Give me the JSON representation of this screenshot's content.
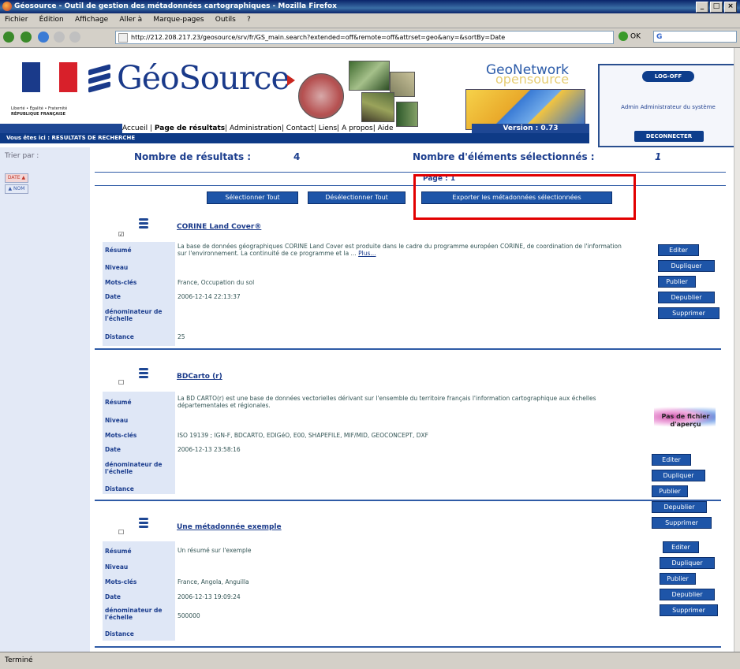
{
  "window": {
    "title": "Géosource - Outil de gestion des métadonnées cartographiques - Mozilla Firefox"
  },
  "menu": [
    "Fichier",
    "Édition",
    "Affichage",
    "Aller à",
    "Marque-pages",
    "Outils",
    "?"
  ],
  "address": {
    "url": "http://212.208.217.23/geosource/srv/fr/GS_main.search?extended=off&remote=off&attrset=geo&any=&sortBy=Date",
    "search_value": "G"
  },
  "header": {
    "rf_text": [
      "Liberté • Égalité • Fraternité",
      "RÉPUBLIQUE FRANÇAISE"
    ],
    "geosource": "GéoSource",
    "geonetwork": "GeoNetwork",
    "opensource": "opensource",
    "nav_links": [
      {
        "label": "Accueil",
        "bold": false
      },
      {
        "label": "Page de résultats",
        "bold": true
      },
      {
        "label": "Administration",
        "bold": false
      },
      {
        "label": "Contact",
        "bold": false
      },
      {
        "label": "Liens",
        "bold": false
      },
      {
        "label": "A propos",
        "bold": false
      },
      {
        "label": "Aide",
        "bold": false
      }
    ],
    "version": "Version : 0.73",
    "login": {
      "status": "LOG-OFF",
      "user": "Admin Administrateur du système",
      "logout": "DECONNECTER"
    },
    "you_are_here": "Vous êtes ici : RESULTATS DE RECHERCHE"
  },
  "sidebar": {
    "sort_label": "Trier par :",
    "sort_options": [
      "DATE ▲",
      "▲ NOM"
    ]
  },
  "results": {
    "count_label": "Nombre de résultats :",
    "count": "4",
    "selected_label": "Nombre d'éléments sélectionnés :",
    "selected": "1",
    "page_label": "Page :",
    "page": "1",
    "select_all": "Sélectionner Tout",
    "deselect_all": "Désélectionner Tout",
    "export": "Exporter les métadonnées sélectionnées"
  },
  "field_labels": {
    "resume": "Résumé",
    "niveau": "Niveau",
    "mots_cles": "Mots-clés",
    "date": "Date",
    "denominateur": "dénominateur de l'échelle",
    "distance": "Distance"
  },
  "actions": [
    "Editer",
    "Dupliquer",
    "Publier",
    "Depublier",
    "Supprimer"
  ],
  "thumbnail_text": "Pas de fichier d'aperçu",
  "records": [
    {
      "checked": "☑",
      "title": "CORINE Land Cover®",
      "resume": "La base de données géographiques CORINE Land Cover est produite dans le cadre du programme européen CORINE, de coordination de l'information sur l'environnement. La continuité de ce programme et la ...",
      "more": "Plus...",
      "niveau": "",
      "mots_cles": "France, Occupation du sol",
      "date": "2006-12-14 22:13:37",
      "denominateur": "",
      "distance": "25"
    },
    {
      "checked": "☐",
      "title": "BDCarto (r)",
      "resume": "La BD CARTO(r) est une base de données vectorielles dérivant sur l'ensemble du territoire français l'information cartographique aux échelles départementales et régionales.",
      "more": "",
      "niveau": "",
      "mots_cles": "ISO 19139 ; IGN-F, BDCARTO, EDIGéO, E00, SHAPEFILE, MIF/MID, GEOCONCEPT, DXF",
      "date": "2006-12-13 23:58:16",
      "denominateur": "",
      "distance": ""
    },
    {
      "checked": "☐",
      "title": "Une métadonnée exemple",
      "resume": "Un résumé sur l'exemple",
      "more": "",
      "niveau": "",
      "mots_cles": "France, Angola, Anguilla",
      "date": "2006-12-13 19:09:24",
      "denominateur": "500000",
      "distance": ""
    }
  ],
  "status": "Terminé",
  "colors": {
    "brand_blue": "#1c3e8e",
    "button_blue": "#1e55a8",
    "highlight": "#e20000"
  }
}
